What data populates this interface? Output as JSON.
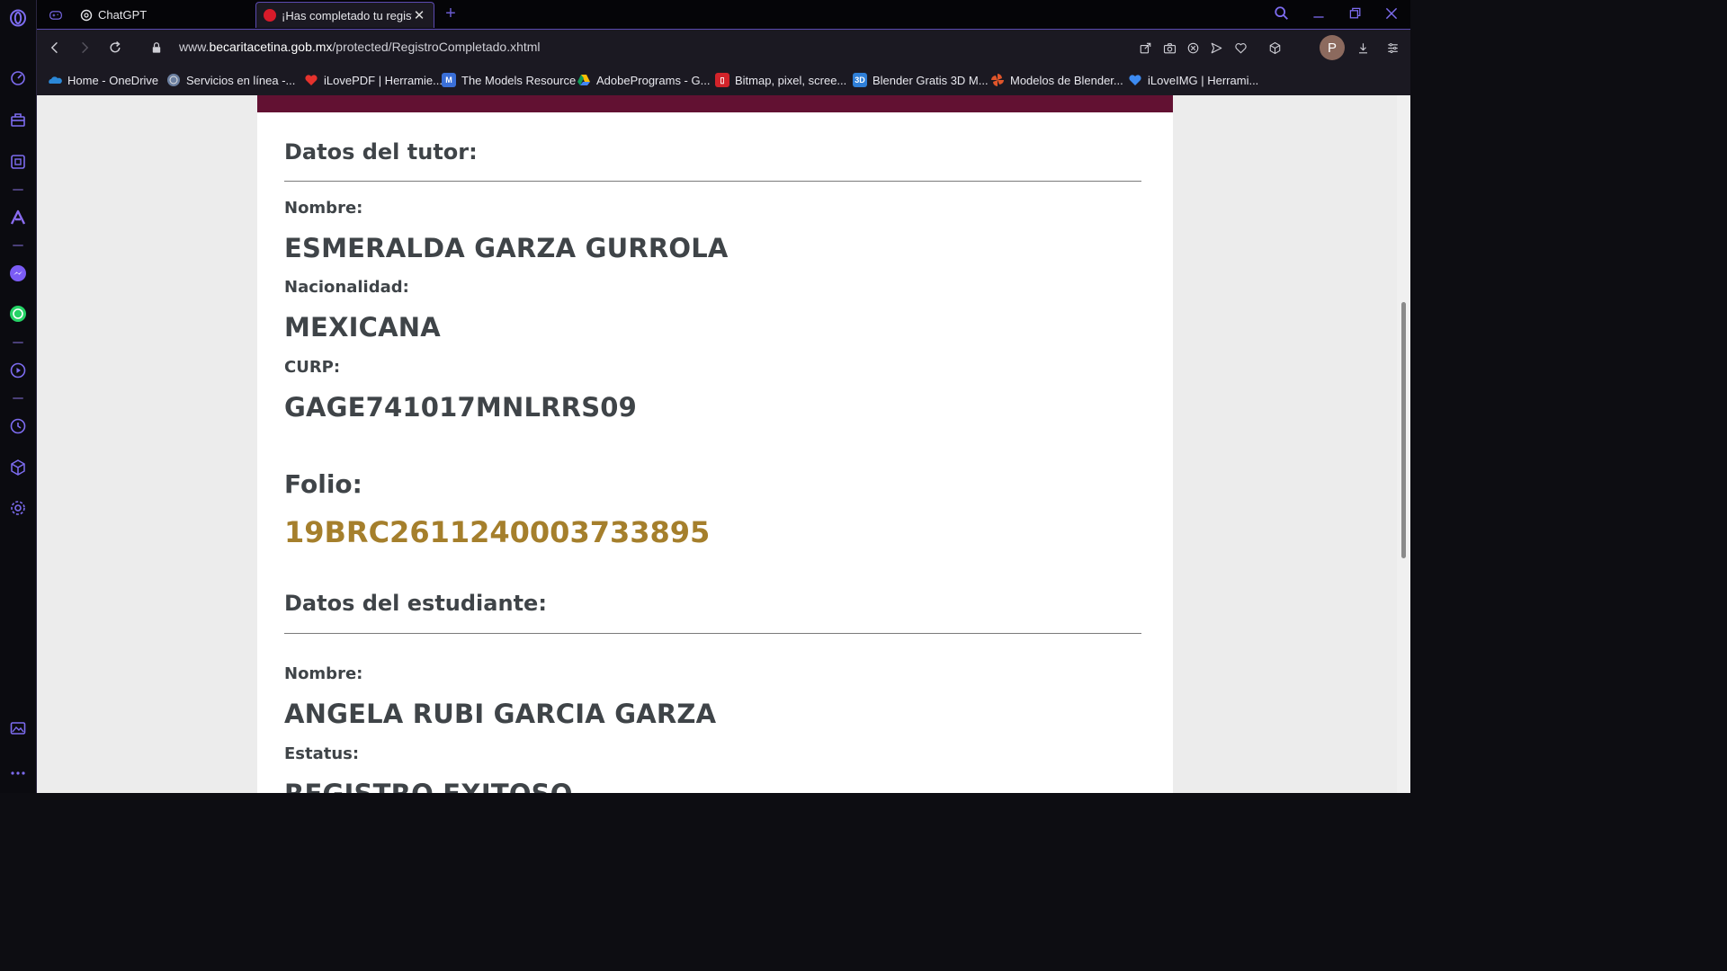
{
  "browser": {
    "tabs": [
      {
        "label": "ChatGPT"
      },
      {
        "label": "¡Has completado tu registro"
      }
    ],
    "url_prefix": "www.",
    "url_domain": "becaritacetina.gob.mx",
    "url_path": "/protected/RegistroCompletado.xhtml",
    "profile_initial": "P",
    "bookmarks": [
      {
        "label": "Home - OneDrive",
        "icon": "onedrive-icon",
        "color": "#2b88d8"
      },
      {
        "label": "Servicios en línea -...",
        "icon": "seal-icon",
        "color": "#6b7fa0"
      },
      {
        "label": "iLovePDF | Herramie...",
        "icon": "heart-icon",
        "color": "#e5322d"
      },
      {
        "label": "The Models Resource",
        "icon": "m-icon",
        "color": "#3a6fd8"
      },
      {
        "label": "AdobePrograms - G...",
        "icon": "drive-icon",
        "color": "#fbbc04"
      },
      {
        "label": "Bitmap, pixel, scree...",
        "icon": "doc-icon",
        "color": "#d2232a"
      },
      {
        "label": "Blender Gratis 3D M...",
        "icon": "3d-icon",
        "color": "#2f7fd8"
      },
      {
        "label": "Modelos de Blender...",
        "icon": "pinwheel-icon",
        "color": "#e0552a"
      },
      {
        "label": "iLoveIMG | Herrami...",
        "icon": "heart-icon",
        "color": "#3d8bf2"
      }
    ]
  },
  "page": {
    "tutor_heading": "Datos del tutor:",
    "tutor": {
      "name_label": "Nombre:",
      "name_value": "ESMERALDA GARZA GURROLA",
      "nationality_label": "Nacionalidad:",
      "nationality_value": "MEXICANA",
      "curp_label": "CURP:",
      "curp_value": "GAGE741017MNLRRS09"
    },
    "folio_label": "Folio:",
    "folio_value": "19BRC2611240003733895",
    "student_heading": "Datos del estudiante:",
    "student": {
      "name_label": "Nombre:",
      "name_value": "ANGELA RUBI GARCIA GARZA",
      "status_label": "Estatus:",
      "status_value": "REGISTRO EXITOSO"
    }
  },
  "colors": {
    "accent": "#621132",
    "folio": "#a57f2c",
    "browser_accent": "#5b4ab0"
  }
}
